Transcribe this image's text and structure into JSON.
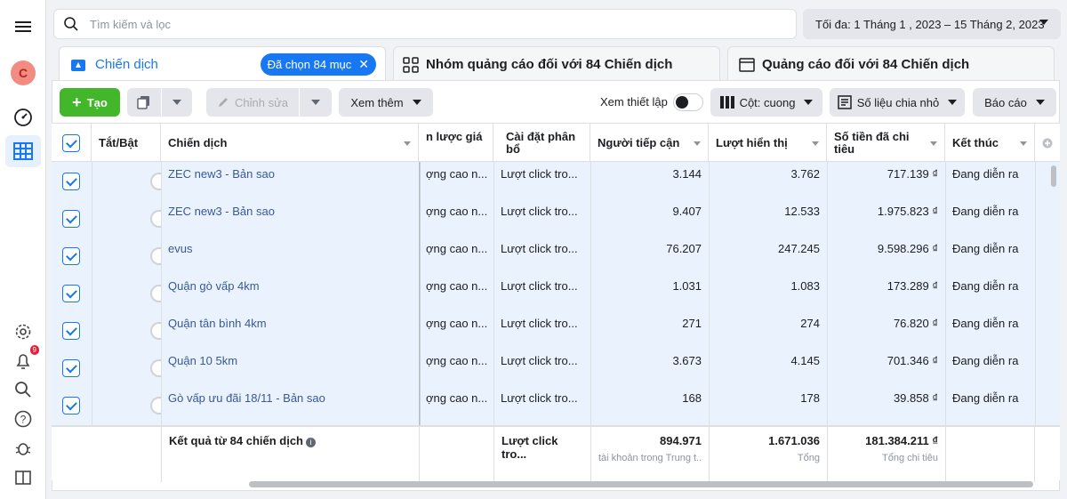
{
  "search": {
    "placeholder": "Tìm kiếm và lọc"
  },
  "date_range": "Tối đa: 1 Tháng 1 , 2023 – 15 Tháng 2, 2023",
  "notifications_count": "9",
  "avatar_letter": "C",
  "tabs": [
    {
      "label": "Chiến dịch",
      "selected_pill": "Đã chọn 84 mục"
    },
    {
      "label": "Nhóm quảng cáo đối với 84 Chiến dịch"
    },
    {
      "label": "Quảng cáo đối với 84 Chiến dịch"
    }
  ],
  "toolbar": {
    "create": "Tạo",
    "edit": "Chỉnh sửa",
    "more": "Xem thêm",
    "view_setup": "Xem thiết lập",
    "columns": "Cột: cuong",
    "breakdown": "Số liệu chia nhỏ",
    "report": "Báo cáo"
  },
  "columns": {
    "toggle": "Tắt/Bật",
    "campaign": "Chiến dịch",
    "bid": "n lược giá",
    "attribution": "Cài đặt phân bổ",
    "reach": "Người tiếp cận",
    "impressions": "Lượt hiển thị",
    "spent": "Số tiền đã chi tiêu",
    "ends": "Kết thúc"
  },
  "rows": [
    {
      "name": "ZEC new3 - Bản sao",
      "bid": "ợng cao n...",
      "attr": "Lượt click tro...",
      "reach": "3.144",
      "impr": "3.762",
      "spent": "717.139 ₫",
      "end": "Đang diễn ra"
    },
    {
      "name": "ZEC new3 - Bản sao",
      "bid": "ợng cao n...",
      "attr": "Lượt click tro...",
      "reach": "9.407",
      "impr": "12.533",
      "spent": "1.975.823 ₫",
      "end": "Đang diễn ra"
    },
    {
      "name": "evus",
      "bid": "ợng cao n...",
      "attr": "Lượt click tro...",
      "reach": "76.207",
      "impr": "247.245",
      "spent": "9.598.296 ₫",
      "end": "Đang diễn ra"
    },
    {
      "name": "Quận gò vấp 4km",
      "bid": "ợng cao n...",
      "attr": "Lượt click tro...",
      "reach": "1.031",
      "impr": "1.083",
      "spent": "173.289 ₫",
      "end": "Đang diễn ra"
    },
    {
      "name": "Quận tân bình 4km",
      "bid": "ợng cao n...",
      "attr": "Lượt click tro...",
      "reach": "271",
      "impr": "274",
      "spent": "76.820 ₫",
      "end": "Đang diễn ra"
    },
    {
      "name": "Quận 10 5km",
      "bid": "ợng cao n...",
      "attr": "Lượt click tro...",
      "reach": "3.673",
      "impr": "4.145",
      "spent": "701.346 ₫",
      "end": "Đang diễn ra"
    },
    {
      "name": "Gò vấp ưu đãi 18/11 - Bản sao",
      "bid": "ợng cao n...",
      "attr": "Lượt click tro...",
      "reach": "168",
      "impr": "178",
      "spent": "39.858 ₫",
      "end": "Đang diễn ra"
    }
  ],
  "footer": {
    "label": "Kết quả từ 84 chiến dịch",
    "attr": "Lượt click tro...",
    "reach": "894.971",
    "reach_sub": "tài khoản trong Trung t...",
    "impr": "1.671.036",
    "impr_sub": "Tổng",
    "spent": "181.384.211 ₫",
    "spent_sub": "Tổng chi tiêu"
  }
}
